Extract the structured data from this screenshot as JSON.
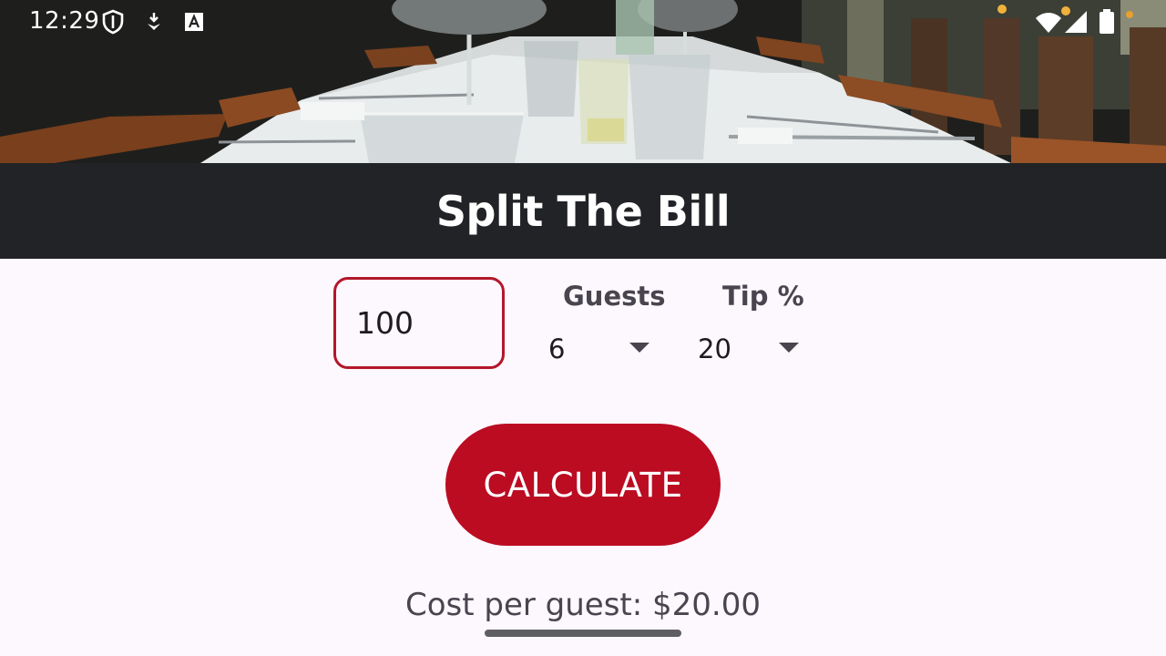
{
  "status_bar": {
    "time": "12:29",
    "left_icons": [
      "shield-icon",
      "download-icon",
      "text-a-icon"
    ],
    "right_icons": [
      "wifi-icon",
      "signal-icon",
      "battery-icon"
    ]
  },
  "header": {
    "title": "Split The Bill",
    "background": "#222326"
  },
  "bill": {
    "value": "100"
  },
  "guests": {
    "label": "Guests",
    "selected": "6"
  },
  "tip": {
    "label": "Tip %",
    "selected": "20"
  },
  "calculate": {
    "label": "CALCULATE",
    "color": "#bb0c22"
  },
  "result": {
    "text": "Cost per guest: $20.00"
  },
  "colors": {
    "accent": "#bb0c22",
    "input_border": "#b3172a",
    "background": "#fdf7fe"
  }
}
